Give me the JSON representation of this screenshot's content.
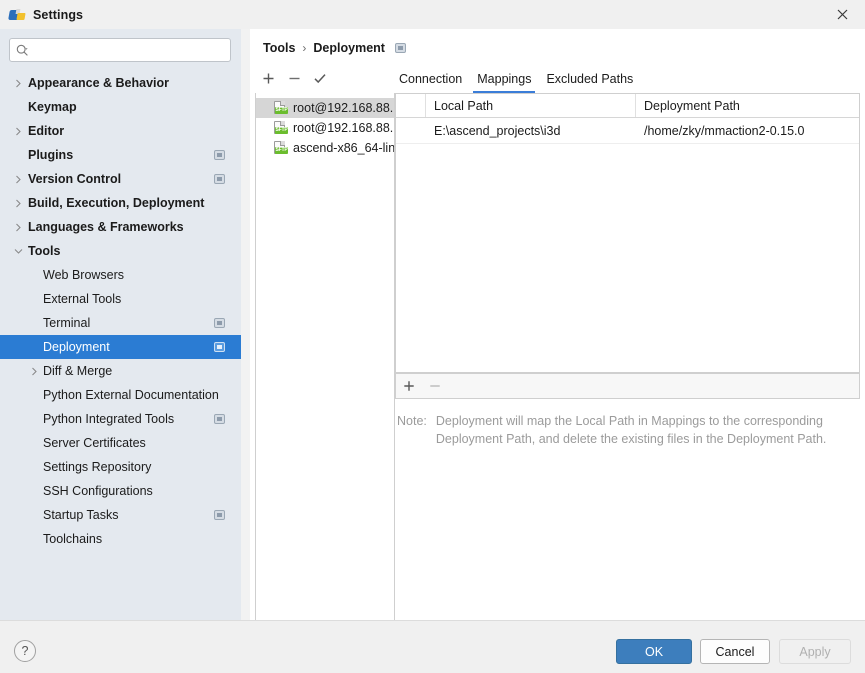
{
  "window": {
    "title": "Settings",
    "icon": "pycharm-logo-icon",
    "close_label": "✕"
  },
  "search": {
    "placeholder": "",
    "value": "",
    "icon": "search-icon"
  },
  "sidebar": {
    "items": [
      {
        "label": "Appearance & Behavior",
        "depth": 0,
        "arrow": "collapsed",
        "badge": false,
        "selected": false
      },
      {
        "label": "Keymap",
        "depth": 0,
        "arrow": "none",
        "badge": false,
        "selected": false
      },
      {
        "label": "Editor",
        "depth": 0,
        "arrow": "collapsed",
        "badge": false,
        "selected": false
      },
      {
        "label": "Plugins",
        "depth": 0,
        "arrow": "none",
        "badge": true,
        "selected": false
      },
      {
        "label": "Version Control",
        "depth": 0,
        "arrow": "collapsed",
        "badge": true,
        "selected": false
      },
      {
        "label": "Build, Execution, Deployment",
        "depth": 0,
        "arrow": "collapsed",
        "badge": false,
        "selected": false
      },
      {
        "label": "Languages & Frameworks",
        "depth": 0,
        "arrow": "collapsed",
        "badge": false,
        "selected": false
      },
      {
        "label": "Tools",
        "depth": 0,
        "arrow": "expanded",
        "badge": false,
        "selected": false
      },
      {
        "label": "Web Browsers",
        "depth": 1,
        "arrow": "none",
        "badge": false,
        "selected": false
      },
      {
        "label": "External Tools",
        "depth": 1,
        "arrow": "none",
        "badge": false,
        "selected": false
      },
      {
        "label": "Terminal",
        "depth": 1,
        "arrow": "none",
        "badge": true,
        "selected": false
      },
      {
        "label": "Deployment",
        "depth": 1,
        "arrow": "none",
        "badge": true,
        "selected": true
      },
      {
        "label": "Diff & Merge",
        "depth": 1,
        "arrow": "collapsed",
        "badge": false,
        "selected": false
      },
      {
        "label": "Python External Documentation",
        "depth": 1,
        "arrow": "none",
        "badge": false,
        "selected": false
      },
      {
        "label": "Python Integrated Tools",
        "depth": 1,
        "arrow": "none",
        "badge": true,
        "selected": false
      },
      {
        "label": "Server Certificates",
        "depth": 1,
        "arrow": "none",
        "badge": false,
        "selected": false
      },
      {
        "label": "Settings Repository",
        "depth": 1,
        "arrow": "none",
        "badge": false,
        "selected": false
      },
      {
        "label": "SSH Configurations",
        "depth": 1,
        "arrow": "none",
        "badge": false,
        "selected": false
      },
      {
        "label": "Startup Tasks",
        "depth": 1,
        "arrow": "none",
        "badge": true,
        "selected": false
      },
      {
        "label": "Toolchains",
        "depth": 1,
        "arrow": "none",
        "badge": false,
        "selected": false
      }
    ]
  },
  "breadcrumb": {
    "root": "Tools",
    "separator": "›",
    "current": "Deployment"
  },
  "list_toolbar": {
    "add": "+",
    "remove": "−",
    "set_default": "✓"
  },
  "servers": {
    "items": [
      {
        "name": "root@192.168.88.",
        "icon": "sftp-server-icon",
        "tag": "SFTP",
        "selected": true
      },
      {
        "name": "root@192.168.88.",
        "icon": "sftp-server-icon",
        "tag": "SFTP",
        "selected": false
      },
      {
        "name": "ascend-x86_64-lin",
        "icon": "sftp-server-icon",
        "tag": "SFTP",
        "selected": false
      }
    ]
  },
  "tabs": [
    {
      "label": "Connection",
      "active": false
    },
    {
      "label": "Mappings",
      "active": true
    },
    {
      "label": "Excluded Paths",
      "active": false
    }
  ],
  "table": {
    "columns": [
      "",
      "Local Path",
      "Deployment Path"
    ],
    "rows": [
      {
        "marker": "",
        "local_path": "E:\\ascend_projects\\i3d",
        "deployment_path": "/home/zky/mmaction2-0.15.0"
      }
    ]
  },
  "table_toolbar": {
    "add": "+",
    "remove": "−"
  },
  "note": {
    "label": "Note:",
    "text": "Deployment will map the Local Path in Mappings to the corresponding Deployment Path, and delete the existing files in the Deployment Path."
  },
  "footer": {
    "help": "?",
    "ok": "OK",
    "cancel": "Cancel",
    "apply": "Apply"
  },
  "colors": {
    "selection_blue": "#2b7cd3",
    "tab_underline": "#3b7dd8",
    "ok_button": "#3d7ebd",
    "sftp_green": "#6bbd2e",
    "sidebar_bg": "#e4e9ef",
    "note_gray": "#9b9b9b"
  }
}
